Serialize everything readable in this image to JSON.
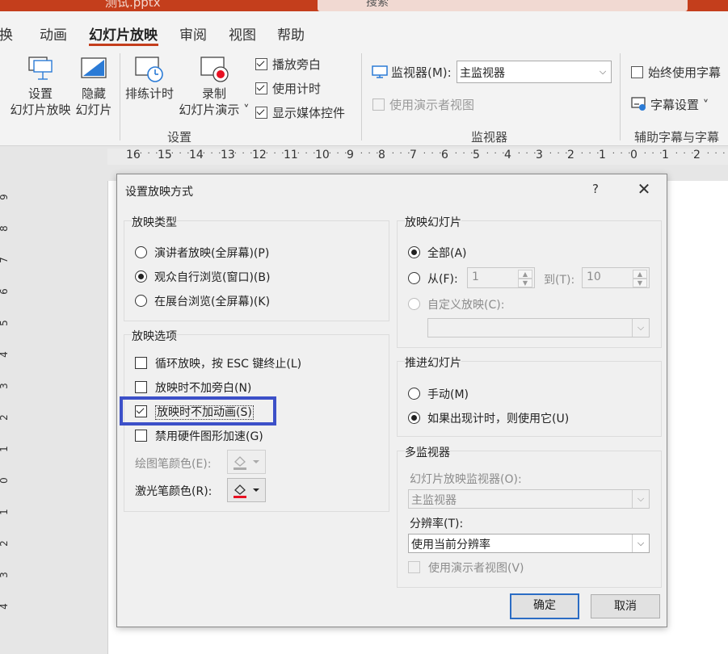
{
  "titlebar": {
    "filename": "测试.pptx",
    "search_placeholder": "搜索"
  },
  "tabs": [
    "换",
    "动画",
    "幻灯片放映",
    "审阅",
    "视图",
    "帮助"
  ],
  "active_tab": "幻灯片放映",
  "ribbon": {
    "setup_button": [
      "设置",
      "幻灯片放映"
    ],
    "hide_button": [
      "隐藏",
      "幻灯片"
    ],
    "rehearse_button": "排练计时",
    "record_button": [
      "录制",
      "幻灯片演示 ˅"
    ],
    "check_narration": "播放旁白",
    "check_timings": "使用计时",
    "check_media": "显示媒体控件",
    "group_setup": "设置",
    "monitor_label": "监视器(M):",
    "monitor_value": "主监视器",
    "presenter_view": "使用演示者视图",
    "group_monitors": "监视器",
    "always_subtitles": "始终使用字幕",
    "subtitle_settings": "字幕设置 ˅",
    "group_captions": "辅助字幕与字幕"
  },
  "ruler_top": [
    "16",
    "15",
    "14",
    "13",
    "12",
    "11",
    "10",
    "9",
    "8",
    "7",
    "6",
    "5",
    "4",
    "3",
    "2",
    "1",
    "0",
    "1",
    "2"
  ],
  "ruler_left": [
    "9",
    "8",
    "7",
    "6",
    "5",
    "4",
    "3",
    "2",
    "1",
    "0",
    "1",
    "2",
    "3",
    "4"
  ],
  "dialog": {
    "title": "设置放映方式",
    "help": "?",
    "show_type": {
      "title": "放映类型",
      "options": [
        "演讲者放映(全屏幕)(P)",
        "观众自行浏览(窗口)(B)",
        "在展台浏览(全屏幕)(K)"
      ],
      "selected_index": 1
    },
    "show_options": {
      "title": "放映选项",
      "loop": "循环放映，按 ESC 键终止(L)",
      "no_narration": "放映时不加旁白(N)",
      "no_animation": "放映时不加动画(S)",
      "disable_hw": "禁用硬件图形加速(G)",
      "pen_color": "绘图笔颜色(E):",
      "laser_color": "激光笔颜色(R):",
      "laser_color_hex": "#e81123"
    },
    "show_slides": {
      "title": "放映幻灯片",
      "all": "全部(A)",
      "from": "从(F):",
      "from_value": "1",
      "to": "到(T):",
      "to_value": "10",
      "custom": "自定义放映(C):"
    },
    "advance": {
      "title": "推进幻灯片",
      "manual": "手动(M)",
      "timings": "如果出现计时，则使用它(U)"
    },
    "multi_monitor": {
      "title": "多监视器",
      "monitor_label": "幻灯片放映监视器(O):",
      "monitor_value": "主监视器",
      "resolution_label": "分辨率(T):",
      "resolution_value": "使用当前分辨率",
      "presenter_view": "使用演示者视图(V)"
    },
    "ok": "确定",
    "cancel": "取消"
  }
}
